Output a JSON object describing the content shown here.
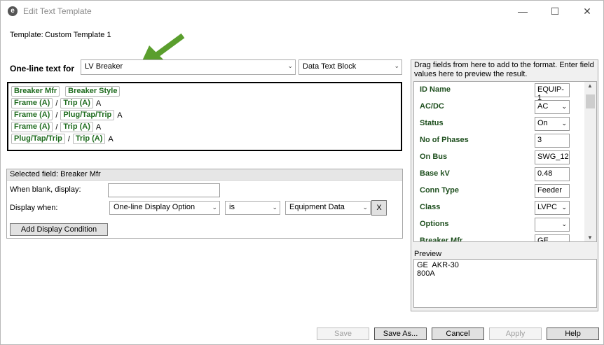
{
  "window": {
    "title": "Edit Text Template",
    "app_icon": "e",
    "icons": {
      "minimize": "minimize-icon",
      "maximize": "maximize-icon",
      "close": "close-icon"
    }
  },
  "template": {
    "label": "Template:",
    "name": "Custom Template 1"
  },
  "oneline": {
    "label": "One-line text for",
    "element_type": "LV Breaker",
    "block_type": "Data Text Block",
    "accent_arrow_color": "#5a9e2d"
  },
  "format_lines": [
    [
      {
        "t": "chip",
        "v": "Breaker Mfr"
      },
      {
        "t": "sep"
      },
      {
        "t": "chip",
        "v": "Breaker Style"
      }
    ],
    [
      {
        "t": "chip",
        "v": "Frame (A)"
      },
      {
        "t": "plain",
        "v": "/"
      },
      {
        "t": "chip",
        "v": "Trip (A)"
      },
      {
        "t": "plain",
        "v": "A"
      }
    ],
    [
      {
        "t": "chip",
        "v": "Frame (A)"
      },
      {
        "t": "plain",
        "v": "/"
      },
      {
        "t": "chip",
        "v": "Plug/Tap/Trip"
      },
      {
        "t": "plain",
        "v": "A"
      }
    ],
    [
      {
        "t": "chip",
        "v": "Frame (A)"
      },
      {
        "t": "plain",
        "v": "/"
      },
      {
        "t": "chip",
        "v": "Trip (A)"
      },
      {
        "t": "plain",
        "v": "A"
      }
    ],
    [
      {
        "t": "chip",
        "v": "Plug/Tap/Trip"
      },
      {
        "t": "plain",
        "v": "/"
      },
      {
        "t": "chip",
        "v": "Trip (A)"
      },
      {
        "t": "plain",
        "v": "A"
      }
    ]
  ],
  "selected_field": {
    "header": "Selected field: Breaker Mfr",
    "when_blank_label": "When blank, display:",
    "when_blank_value": "",
    "display_when_label": "Display when:",
    "condition_field": "One-line Display Option",
    "condition_op": "is",
    "condition_value": "Equipment Data",
    "remove_label": "X",
    "add_condition_label": "Add Display Condition"
  },
  "fields_panel": {
    "hint": "Drag fields from here to add to the format.  Enter field values here to preview the result.",
    "fields": [
      {
        "name": "ID Name",
        "value": "EQUIP-1",
        "dropdown": false
      },
      {
        "name": "AC/DC",
        "value": "AC",
        "dropdown": true
      },
      {
        "name": "Status",
        "value": "On",
        "dropdown": true
      },
      {
        "name": "No of Phases",
        "value": "3",
        "dropdown": false
      },
      {
        "name": "On Bus",
        "value": "SWG_12",
        "dropdown": false
      },
      {
        "name": "Base kV",
        "value": "0.48",
        "dropdown": false
      },
      {
        "name": "Conn Type",
        "value": "Feeder",
        "dropdown": false
      },
      {
        "name": "Class",
        "value": "LVPC",
        "dropdown": true
      },
      {
        "name": "Options",
        "value": "",
        "dropdown": true
      },
      {
        "name": "Breaker Mfr",
        "value": "GE",
        "dropdown": false
      }
    ],
    "preview_label": "Preview",
    "preview_lines": [
      "GE  AKR-30",
      "800A"
    ]
  },
  "buttons": {
    "save": "Save",
    "save_as": "Save As...",
    "cancel": "Cancel",
    "apply": "Apply",
    "help": "Help"
  }
}
